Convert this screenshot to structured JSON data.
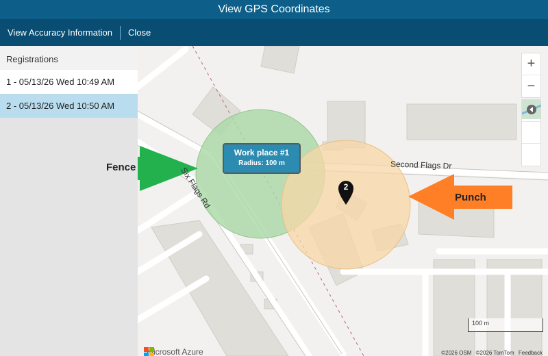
{
  "window": {
    "title": "View GPS Coordinates"
  },
  "toolbar": {
    "accuracy_label": "View Accuracy Information",
    "close_label": "Close"
  },
  "sidebar": {
    "header": "Registrations",
    "items": [
      {
        "label": "1 - 05/13/26 Wed 10:49 AM",
        "selected": false
      },
      {
        "label": "2 - 05/13/26 Wed 10:50 AM",
        "selected": true
      }
    ]
  },
  "map": {
    "fence": {
      "title": "Work place #1",
      "radius": "Radius: 100 m",
      "color": "#a9d8a6"
    },
    "punch": {
      "marker_number": "2",
      "color": "#f8d7a7"
    },
    "streets": {
      "six_flags": "Six Flags Rd",
      "second_flags": "Second Flags Dr"
    },
    "scale": "100 m",
    "brand": "Microsoft Azure",
    "attribution": {
      "osm": "©2026 OSM",
      "tomtom": "©2026 TomTom",
      "feedback": "Feedback"
    },
    "controls": {
      "zoom_in": "+",
      "zoom_out": "−"
    }
  },
  "annotations": {
    "fence_label": "Fence",
    "punch_label": "Punch",
    "fence_arrow_color": "#22b14c",
    "punch_arrow_color": "#ff7f27"
  }
}
